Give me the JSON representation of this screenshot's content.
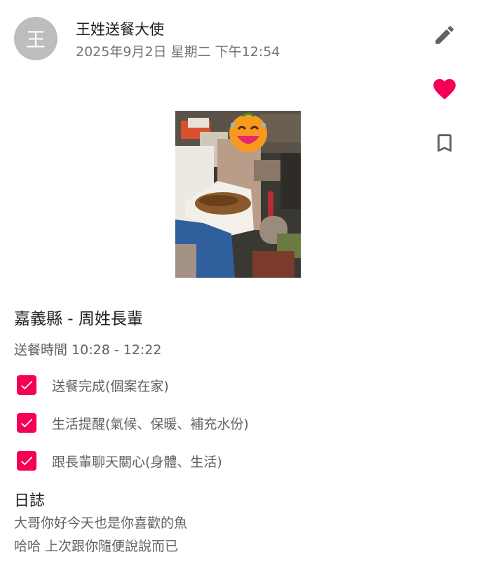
{
  "post": {
    "avatar_initial": "王",
    "author": "王姓送餐大使",
    "timestamp": "2025年9月2日 星期二 下午12:54"
  },
  "actions": {
    "icons": [
      "pencil-icon",
      "heart-icon",
      "bookmark-icon"
    ],
    "heart_color": "#f50057",
    "icon_color": "#616161"
  },
  "photo": {
    "sticker_icon": "laughing-emoji-sticker"
  },
  "record": {
    "title": "嘉義縣 - 周姓長輩",
    "meal_time": "送餐時間 10:28 - 12:22",
    "tasks": [
      {
        "label": "送餐完成(個案在家)",
        "checked": true
      },
      {
        "label": "生活提醒(氣候、保暖、補充水份)",
        "checked": true
      },
      {
        "label": "跟長輩聊天關心(身體、生活)",
        "checked": true
      }
    ],
    "checkbox_color": "#f50057"
  },
  "log": {
    "heading": "日誌",
    "lines": [
      "大哥你好今天也是你喜歡的魚",
      "哈哈 上次跟你隨便說說而已"
    ]
  }
}
